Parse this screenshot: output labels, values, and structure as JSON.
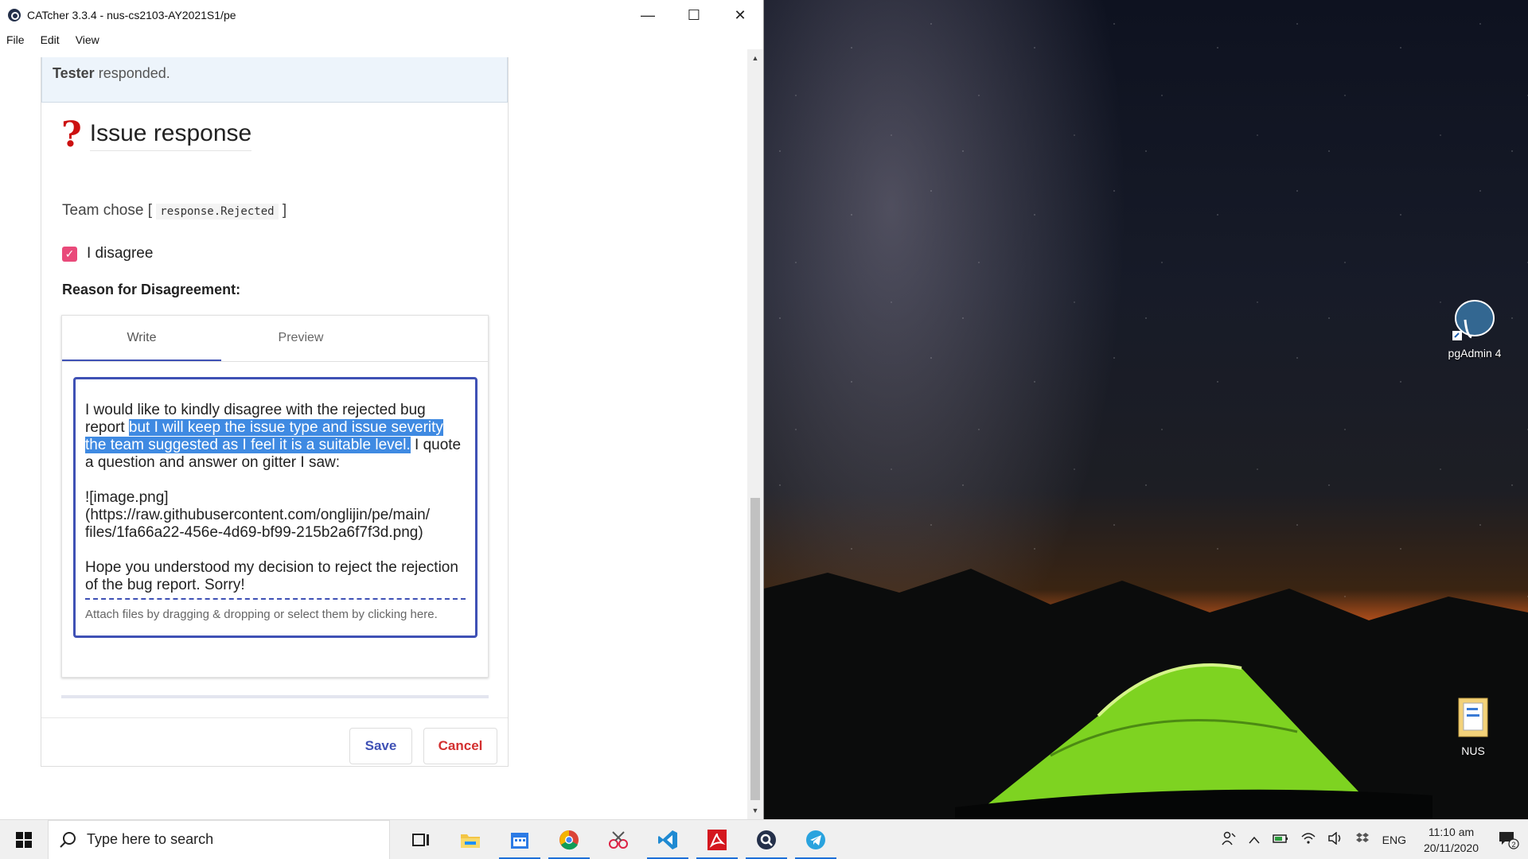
{
  "window": {
    "title": "CATcher 3.3.4 - nus-cs2103-AY2021S1/pe",
    "controls": {
      "minimize": "—",
      "maximize": "☐",
      "close": "✕"
    }
  },
  "menu": [
    "File",
    "Edit",
    "View"
  ],
  "tester_bar": {
    "actor": "Tester",
    "text": "responded."
  },
  "issue_response": {
    "icon": "question-mark-icon",
    "title": "Issue response",
    "team_chose_prefix": "Team chose [",
    "team_chose_value": "response.Rejected",
    "team_chose_suffix": "]",
    "checkbox_label": "I disagree",
    "checkbox_checked": true,
    "reason_label": "Reason for Disagreement:"
  },
  "editor": {
    "tabs": [
      {
        "label": "Write",
        "active": true
      },
      {
        "label": "Preview",
        "active": false
      }
    ],
    "text_part1": "I would like to kindly disagree with the rejected bug report",
    "text_highlight": "but I will keep the issue type and issue severity the team suggested as I feel it is a suitable level.",
    "text_part2": "I quote a question and answer on gitter I saw:",
    "image_line1": "![image.png]",
    "image_line2": "(https://raw.githubusercontent.com/onglijin/pe/main/",
    "image_line3": "files/1fa66a22-456e-4d69-bf99-215b2a6f7f3d.png)",
    "closing": "Hope you understood my decision to reject the rejection of the bug report. Sorry!",
    "attach_hint": "Attach files by dragging & dropping or select them by clicking here."
  },
  "buttons": {
    "save": "Save",
    "cancel": "Cancel"
  },
  "desktop_icons": [
    {
      "label": "pgAdmin 4",
      "icon": "pgadmin-elephant-icon"
    },
    {
      "label": "NUS",
      "icon": "folder-icon"
    }
  ],
  "taskbar": {
    "search_placeholder": "Type here to search",
    "apps": [
      "task-view-icon",
      "file-explorer-icon",
      "calendar-icon",
      "chrome-icon",
      "snipping-tool-icon",
      "vscode-icon",
      "acrobat-icon",
      "catcher-icon",
      "telegram-icon"
    ],
    "tray": {
      "language": "ENG",
      "time": "11:10 am",
      "date": "20/11/2020",
      "notifications": "2"
    }
  }
}
